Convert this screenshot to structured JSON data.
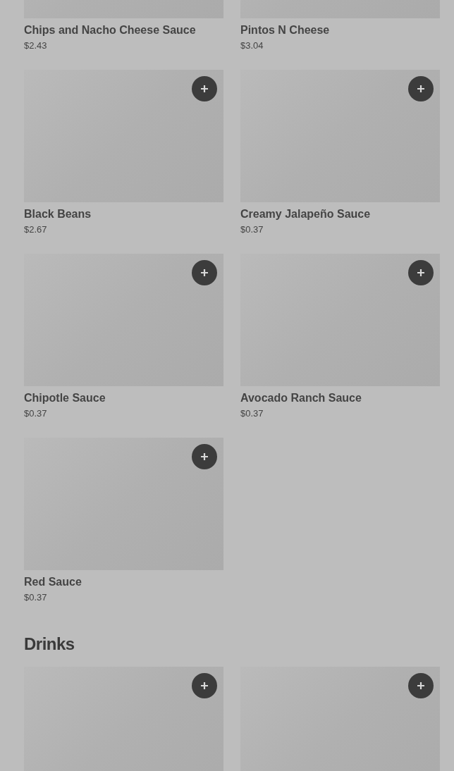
{
  "sections": [
    {
      "items": [
        {
          "name": "Chips and Nacho Cheese Sauce",
          "price": "$2.43"
        },
        {
          "name": "Pintos N Cheese",
          "price": "$3.04"
        },
        {
          "name": "Black Beans",
          "price": "$2.67",
          "add_button": true
        },
        {
          "name": "Creamy Jalapeño Sauce",
          "price": "$0.37",
          "add_button": true
        },
        {
          "name": "Chipotle Sauce",
          "price": "$0.37",
          "add_button": true
        },
        {
          "name": "Avocado Ranch Sauce",
          "price": "$0.37",
          "add_button": true
        },
        {
          "name": "Red Sauce",
          "price": "$0.37",
          "add_button": true
        }
      ]
    },
    {
      "title": "Drinks",
      "items": [
        {
          "add_button": true
        },
        {
          "add_button": true
        }
      ]
    }
  ]
}
